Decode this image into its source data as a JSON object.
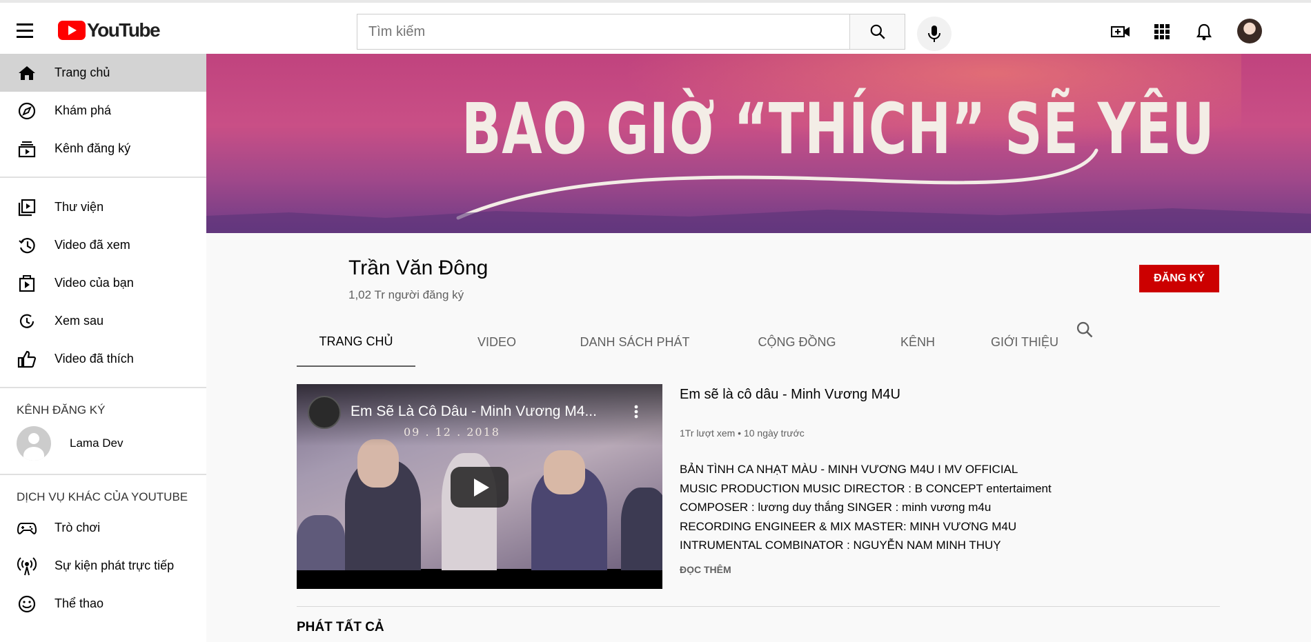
{
  "header": {
    "logo_text": "YouTube",
    "search_placeholder": "Tìm kiếm",
    "colors": {
      "brand_red": "#ff0000",
      "subscribe_red": "#cc0000"
    },
    "icons": [
      "menu-icon",
      "search-icon",
      "mic-icon",
      "create-video-icon",
      "apps-icon",
      "notifications-icon",
      "avatar"
    ]
  },
  "sidebar": {
    "main": [
      {
        "label": "Trang chủ",
        "icon": "home-icon",
        "active": true
      },
      {
        "label": "Khám phá",
        "icon": "compass-icon"
      },
      {
        "label": "Kênh đăng ký",
        "icon": "subscriptions-icon"
      }
    ],
    "library": [
      {
        "label": "Thư viện",
        "icon": "library-icon"
      },
      {
        "label": "Video đã xem",
        "icon": "history-icon"
      },
      {
        "label": "Video của bạn",
        "icon": "your-videos-icon"
      },
      {
        "label": "Xem sau",
        "icon": "watch-later-icon"
      },
      {
        "label": "Video đã thích",
        "icon": "thumbs-up-icon"
      }
    ],
    "subscriptions_heading": "KÊNH ĐĂNG KÝ",
    "subscriptions": [
      {
        "label": "Lama Dev"
      }
    ],
    "more_heading": "DỊCH VỤ KHÁC CỦA YOUTUBE",
    "more": [
      {
        "label": "Trò chơi",
        "icon": "gaming-icon"
      },
      {
        "label": "Sự kiện phát trực tiếp",
        "icon": "live-icon"
      },
      {
        "label": "Thể thao",
        "icon": "sports-icon"
      }
    ]
  },
  "banner": {
    "art_text": "BAO GIỜ “THÍCH” SẼ YÊU"
  },
  "channel": {
    "name": "Trần Văn Đông",
    "subscribers": "1,02 Tr người đăng ký",
    "subscribe_label": "ĐĂNG KÝ"
  },
  "tabs": [
    "TRANG CHỦ",
    "VIDEO",
    "DANH SÁCH PHÁT",
    "CỘNG ĐỒNG",
    "KÊNH",
    "GIỚI THIỆU"
  ],
  "featured": {
    "player_title": "Em Sẽ Là Cô Dâu - Minh Vương M4...",
    "player_date": "09 . 12 . 2018",
    "title": "Em sẽ là cô dâu - Minh Vương M4U",
    "meta": "1Tr lượt xem • 10 ngày trước",
    "description": [
      "BẢN TÌNH CA NHẠT MÀU - MINH VƯƠNG M4U I MV OFFICIAL",
      "MUSIC PRODUCTION MUSIC DIRECTOR : B CONCEPT entertaiment",
      "COMPOSER : lương duy thắng SINGER : minh vương m4u",
      "RECORDING ENGINEER & MIX MASTER: MINH VƯƠNG M4U",
      "INTRUMENTAL COMBINATOR : NGUYỄN NAM MINH THUỴ"
    ],
    "read_more": "ĐỌC THÊM"
  },
  "section": {
    "play_all": "PHÁT TẤT CẢ"
  }
}
